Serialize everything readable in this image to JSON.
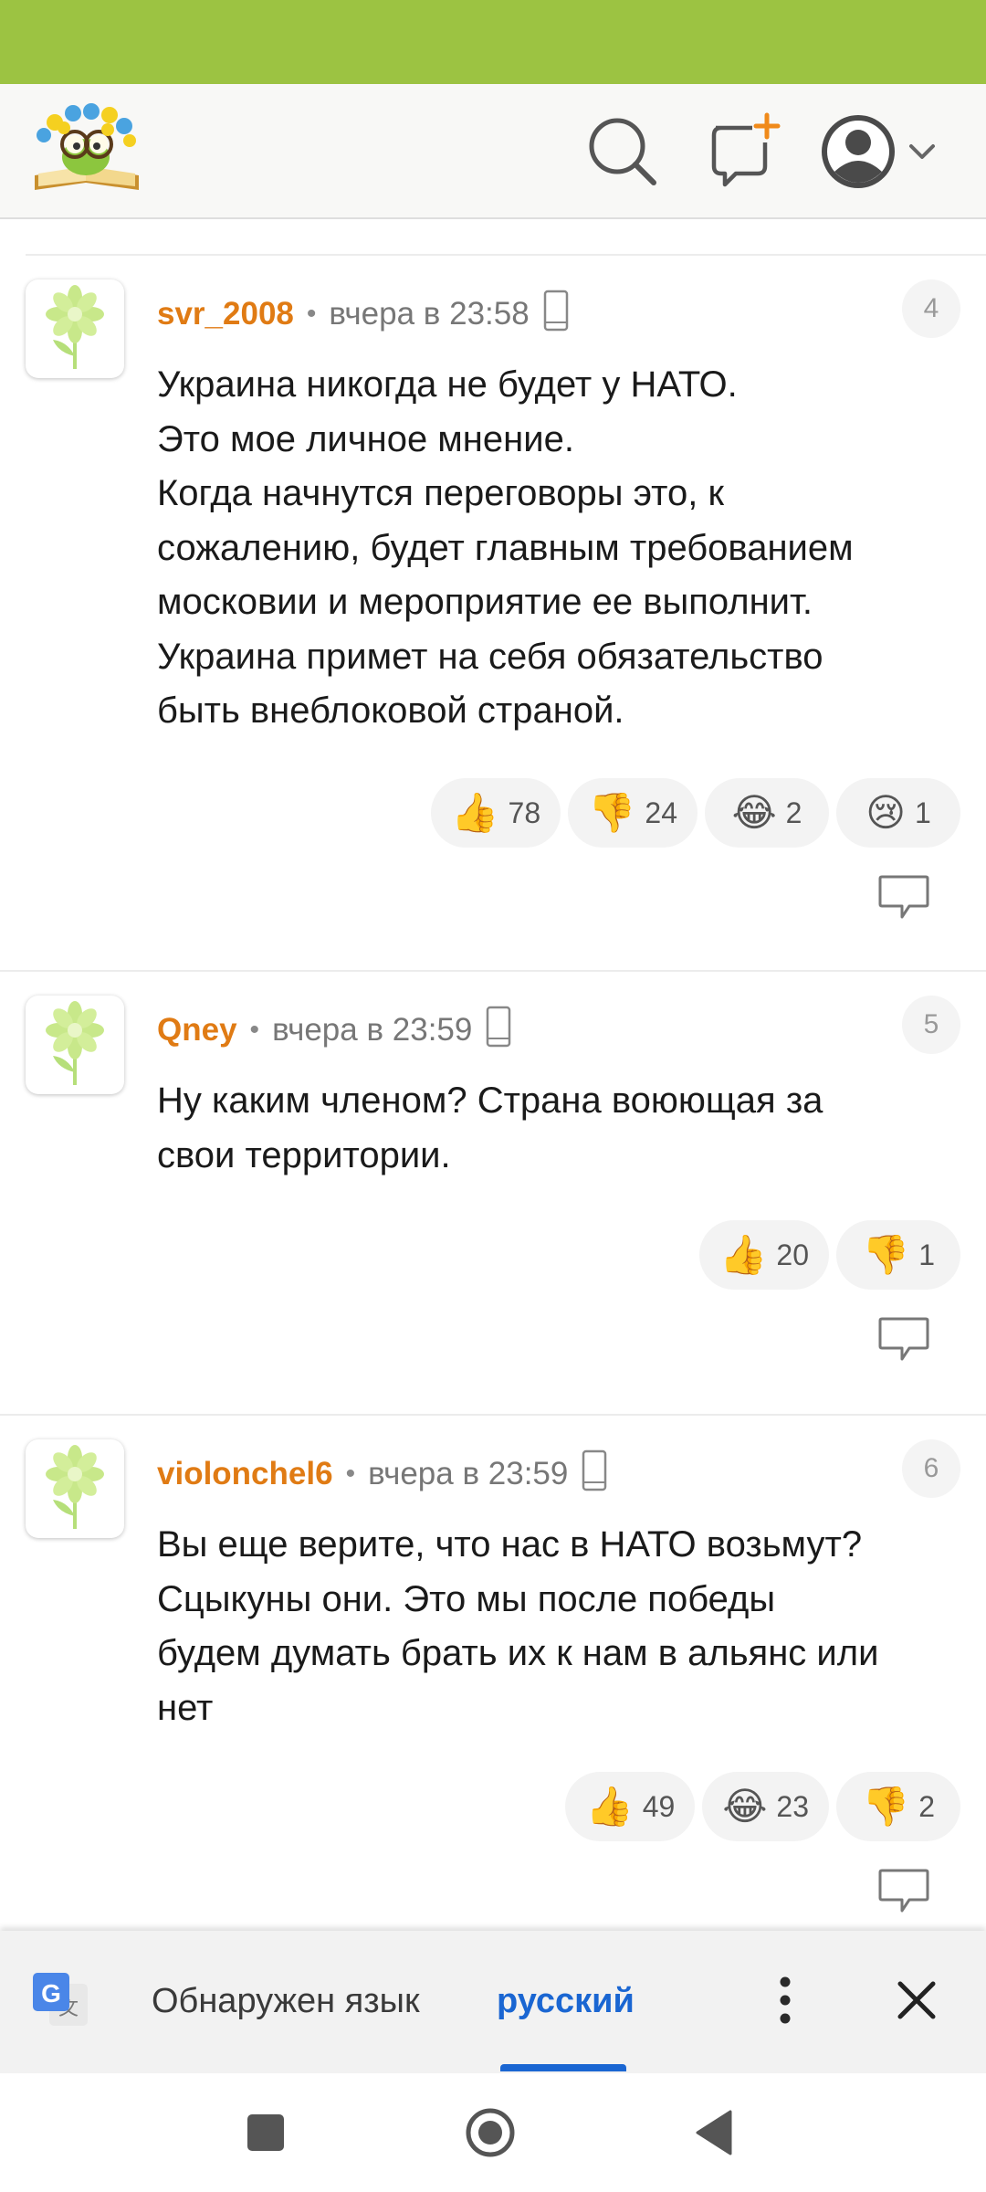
{
  "header": {
    "logo_icon": "book-with-flowers-logo",
    "search_icon": "search-icon",
    "compose_icon": "new-post-icon",
    "profile_icon": "user-avatar-icon",
    "accent_color": "#9cc342"
  },
  "comments": [
    {
      "username": "svr_2008",
      "separator": "•",
      "time": "вчера в 23:58",
      "number": "4",
      "text_lines": [
        "Украина никогда не будет у НАТО.",
        "Это мое личное мнение.",
        "Когда начнутся переговоры это, к",
        "сожалению, будет главным требованием",
        "московии и мероприятие ее выполнит.",
        "Украина примет на себя обязательство",
        "быть внеблоковой страной."
      ],
      "reactions": [
        {
          "emoji": "👍",
          "count": "78"
        },
        {
          "emoji": "👎",
          "count": "24"
        },
        {
          "emoji": "😂",
          "count": "2"
        },
        {
          "emoji": "😢",
          "count": "1"
        }
      ]
    },
    {
      "username": "Qney",
      "separator": "•",
      "time": "вчера в 23:59",
      "number": "5",
      "text_lines": [
        "Ну каким членом? Страна воюющая за",
        "свои территории."
      ],
      "reactions": [
        {
          "emoji": "👍",
          "count": "20"
        },
        {
          "emoji": "👎",
          "count": "1"
        }
      ]
    },
    {
      "username": "violonchel6",
      "separator": "•",
      "time": "вчера в 23:59",
      "number": "6",
      "text_lines": [
        "Вы еще верите, что нас в НАТО возьмут?",
        "Сцыкуны они. Это мы после победы",
        "будем думать брать их к нам в альянс или",
        "нет"
      ],
      "reactions": [
        {
          "emoji": "👍",
          "count": "49"
        },
        {
          "emoji": "😂",
          "count": "23"
        },
        {
          "emoji": "👎",
          "count": "2"
        }
      ]
    }
  ],
  "translate_bar": {
    "detected_label": "Обнаружен язык",
    "language": "русский",
    "icon": "google-translate-icon",
    "more_icon": "more-vertical-icon",
    "close_icon": "close-icon",
    "accent_color": "#1a66d2"
  },
  "nav": {
    "recents_icon": "recents-square-icon",
    "home_icon": "home-circle-icon",
    "back_icon": "back-triangle-icon"
  }
}
